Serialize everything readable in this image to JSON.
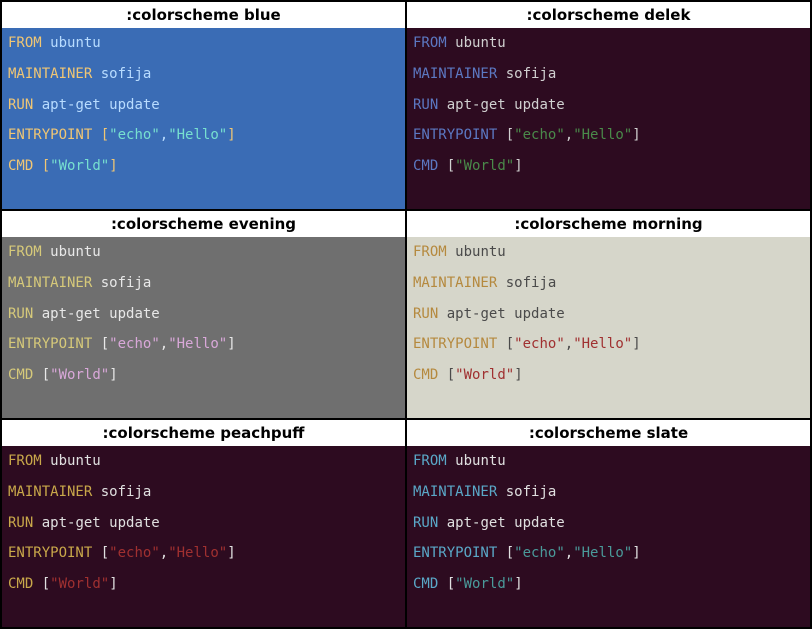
{
  "schemes": [
    {
      "id": "blue",
      "title": ":colorscheme blue",
      "bgClass": "bg-blue",
      "colors": {
        "keyword": "#f0c674",
        "identifier": "#b8dcff",
        "operator": "#b8dcff",
        "bracket": "#f0c674",
        "string": "#77e0d0",
        "comma": "#b8dcff"
      }
    },
    {
      "id": "delek",
      "title": ":colorscheme delek",
      "bgClass": "bg-delek",
      "colors": {
        "keyword": "#5c78c2",
        "identifier": "#d0d0d0",
        "operator": "#d0d0d0",
        "bracket": "#d0d0d0",
        "string": "#4a8a4a",
        "comma": "#d0d0d0"
      }
    },
    {
      "id": "evening",
      "title": ":colorscheme evening",
      "bgClass": "bg-evening",
      "colors": {
        "keyword": "#d6c97a",
        "identifier": "#e8e8e8",
        "operator": "#e8e8e8",
        "bracket": "#e8e8e8",
        "string": "#d9a8d9",
        "comma": "#e8e8e8"
      }
    },
    {
      "id": "morning",
      "title": ":colorscheme morning",
      "bgClass": "bg-morning",
      "colors": {
        "keyword": "#b5893e",
        "identifier": "#4a4a4a",
        "operator": "#4a4a4a",
        "bracket": "#4a4a4a",
        "string": "#a03030",
        "comma": "#4a4a4a"
      }
    },
    {
      "id": "peachpuff",
      "title": ":colorscheme peachpuff",
      "bgClass": "bg-peach",
      "colors": {
        "keyword": "#c9a84a",
        "identifier": "#e0e0e0",
        "operator": "#e0e0e0",
        "bracket": "#e0e0e0",
        "string": "#a03030",
        "comma": "#e0e0e0"
      }
    },
    {
      "id": "slate",
      "title": ":colorscheme slate",
      "bgClass": "bg-slate",
      "colors": {
        "keyword": "#5aa8c8",
        "identifier": "#e0e0e0",
        "operator": "#e0e0e0",
        "bracket": "#e0e0e0",
        "string": "#4a9a9a",
        "comma": "#e0e0e0"
      }
    }
  ],
  "dockerfile": {
    "lines": [
      {
        "tokens": [
          {
            "t": "FROM",
            "c": "keyword"
          },
          {
            "t": " ",
            "c": "identifier"
          },
          {
            "t": "ubuntu",
            "c": "identifier"
          }
        ]
      },
      {
        "blank": true
      },
      {
        "tokens": [
          {
            "t": "MAINTAINER",
            "c": "keyword"
          },
          {
            "t": " ",
            "c": "identifier"
          },
          {
            "t": "sofija",
            "c": "identifier"
          }
        ]
      },
      {
        "blank": true
      },
      {
        "tokens": [
          {
            "t": "RUN",
            "c": "keyword"
          },
          {
            "t": " ",
            "c": "identifier"
          },
          {
            "t": "apt-get update",
            "c": "identifier"
          }
        ]
      },
      {
        "blank": true
      },
      {
        "tokens": [
          {
            "t": "ENTRYPOINT",
            "c": "keyword"
          },
          {
            "t": " ",
            "c": "identifier"
          },
          {
            "t": "[",
            "c": "bracket"
          },
          {
            "t": "\"echo\"",
            "c": "string"
          },
          {
            "t": ",",
            "c": "comma"
          },
          {
            "t": "\"Hello\"",
            "c": "string"
          },
          {
            "t": "]",
            "c": "bracket"
          }
        ]
      },
      {
        "blank": true
      },
      {
        "tokens": [
          {
            "t": "CMD",
            "c": "keyword"
          },
          {
            "t": " ",
            "c": "identifier"
          },
          {
            "t": "[",
            "c": "bracket"
          },
          {
            "t": "\"World\"",
            "c": "string"
          },
          {
            "t": "]",
            "c": "bracket"
          }
        ]
      }
    ]
  }
}
